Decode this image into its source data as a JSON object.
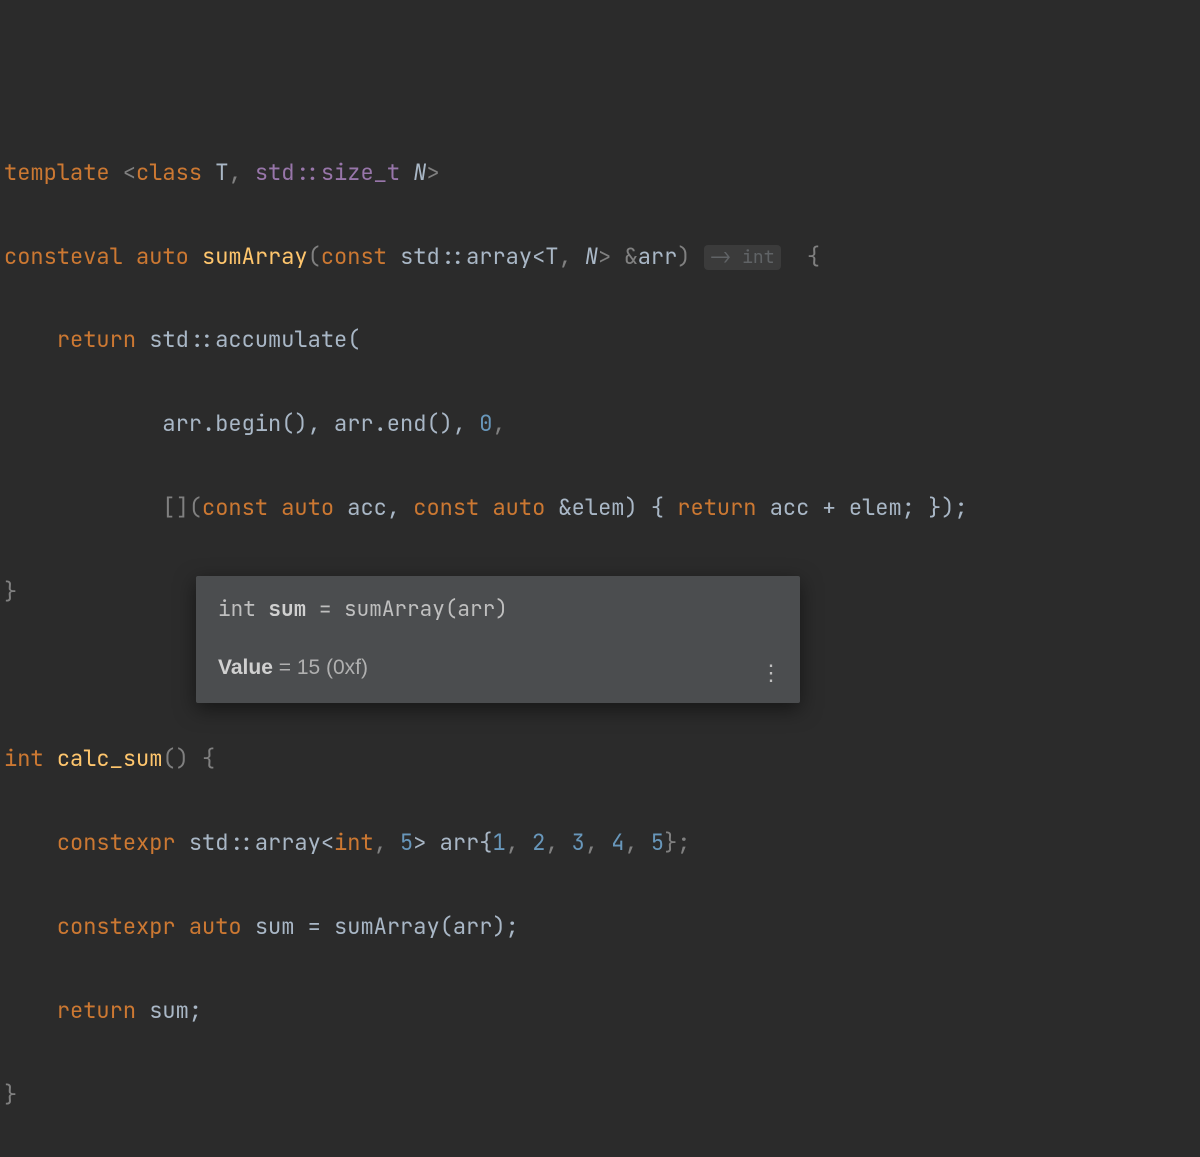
{
  "code": {
    "line1": {
      "kw_template": "template",
      "open": " <",
      "kw_class": "class",
      "space1": " ",
      "T": "T",
      "comma": ", ",
      "size_t": "std::size_t",
      "space2": " ",
      "N": "N",
      "close": ">"
    },
    "line2": {
      "kw_consteval": "consteval",
      "space1": " ",
      "kw_auto": "auto",
      "space2": " ",
      "fn": "sumArray",
      "open_paren": "(",
      "kw_const": "const",
      "space3": " ",
      "stdarray": "std::array<",
      "T": "T",
      "comma": ", ",
      "N": "N",
      "close_tmpl": ">",
      "space4": " &",
      "arr": "arr",
      "close_paren": ") ",
      "hint": "-> int",
      "space5": "  {"
    },
    "line3": {
      "indent": "    ",
      "kw_return": "return",
      "space": " ",
      "accumulate": "std::accumulate("
    },
    "line4": {
      "indent": "            ",
      "text": "arr.begin(), arr.end(), ",
      "zero": "0",
      "comma": ","
    },
    "line5": {
      "indent": "            ",
      "lambda_open": "[](",
      "kw_const1": "const",
      "space1": " ",
      "kw_auto1": "auto",
      "space2": " acc, ",
      "kw_const2": "const",
      "space3": " ",
      "kw_auto2": "auto",
      "space4": " &elem) { ",
      "kw_return": "return",
      "space5": " acc + elem; });"
    },
    "line6": {
      "brace": "}"
    },
    "line8": {
      "kw_int": "int",
      "space1": " ",
      "fn": "calc_sum",
      "open": "() {"
    },
    "line9": {
      "indent": "    ",
      "kw_constexpr": "constexpr",
      "space1": " ",
      "stdarray": "std::array<",
      "kw_int": "int",
      "comma1": ", ",
      "five": "5",
      "close_tmpl": "> arr{",
      "n1": "1",
      "c1": ", ",
      "n2": "2",
      "c2": ", ",
      "n3": "3",
      "c3": ", ",
      "n4": "4",
      "c4": ", ",
      "n5": "5",
      "close": "};"
    },
    "line10": {
      "indent": "    ",
      "kw_constexpr": "constexpr",
      "space1": " ",
      "kw_auto": "auto",
      "space2": " sum = sumArray(arr);"
    },
    "line11": {
      "indent": "    ",
      "kw_return": "return",
      "space": " sum;"
    },
    "line12": {
      "brace": "}"
    }
  },
  "tooltip": {
    "decl_prefix": "int ",
    "decl_name": "sum",
    "decl_suffix": " = sumArray(arr)",
    "value_label": "Value",
    "value_eq": " = ",
    "value_text": "15 (0xf)"
  }
}
